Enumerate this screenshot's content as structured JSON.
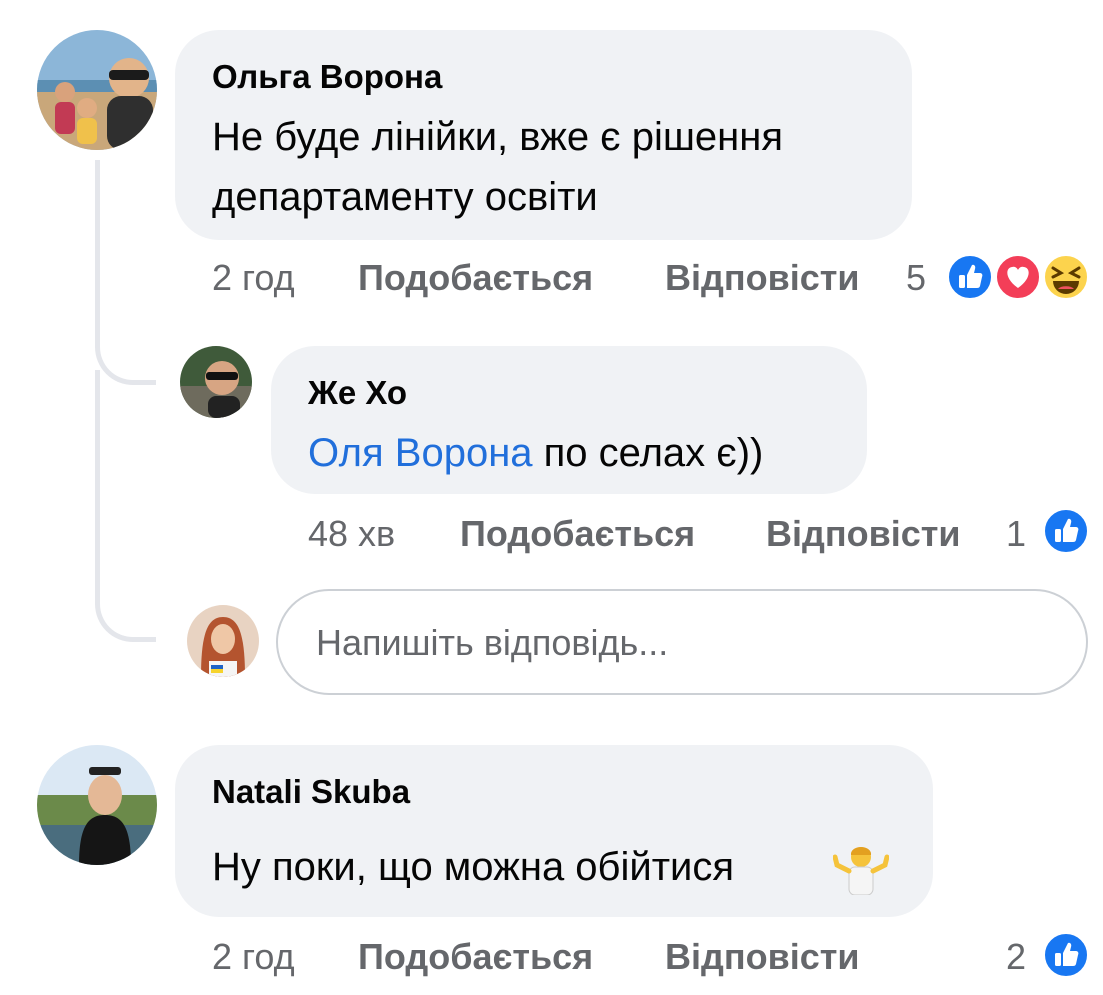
{
  "comments": [
    {
      "author": "Ольга Ворона",
      "text_line1": "Не буде лінійки, вже є рішення",
      "text_line2": "департаменту освіти",
      "time": "2 год",
      "like_label": "Подобається",
      "reply_label": "Відповісти",
      "reaction_count": "5",
      "reactions": [
        "like-icon",
        "love-icon",
        "haha-icon"
      ]
    },
    {
      "author": "Natali Skuba",
      "text": "Ну поки, що можна обійтися",
      "emoji": "person-shrugging-icon",
      "time": "2 год",
      "like_label": "Подобається",
      "reply_label": "Відповісти",
      "reaction_count": "2",
      "reactions": [
        "like-icon"
      ]
    }
  ],
  "reply": {
    "author": "Же Хо",
    "mention": "Оля Ворона",
    "text": " по селах є))",
    "time": "48 хв",
    "like_label": "Подобається",
    "reply_label": "Відповісти",
    "reaction_count": "1",
    "reactions": [
      "like-icon"
    ]
  },
  "reply_input": {
    "placeholder": "Напишіть відповідь..."
  },
  "colors": {
    "bubble": "#f0f2f5",
    "meta_text": "#65676b",
    "mention": "#216fdb",
    "like": "#1877f2",
    "love": "#f33e58"
  }
}
